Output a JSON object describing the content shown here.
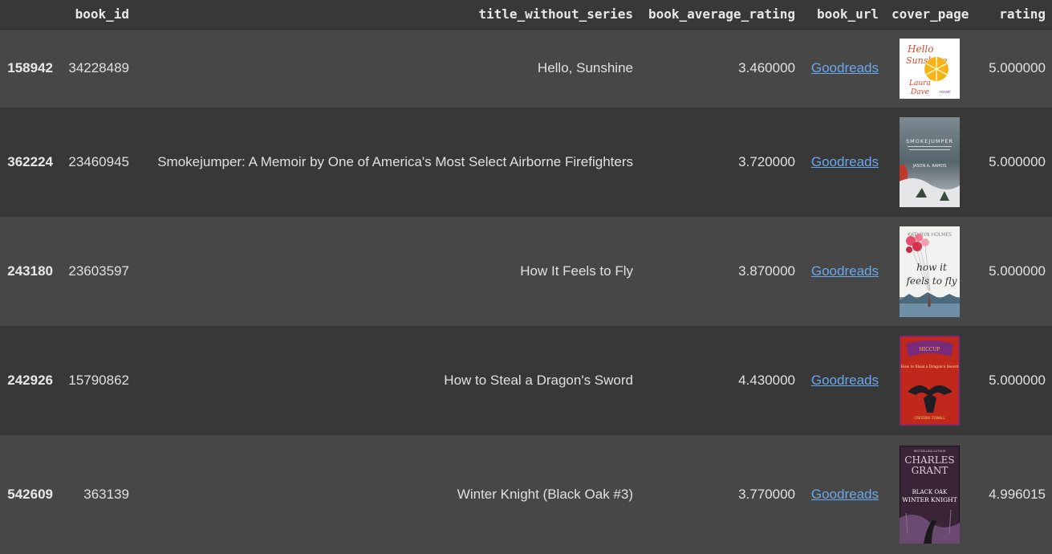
{
  "columns": [
    "",
    "book_id",
    "title_without_series",
    "book_average_rating",
    "book_url",
    "cover_page",
    "rating"
  ],
  "rows": [
    {
      "index": "158942",
      "book_id": "34228489",
      "title": "Hello, Sunshine",
      "avg_rating": "3.460000",
      "url_label": "Goodreads",
      "cover": {
        "name": "hello-sunshine-cover",
        "text_main": "Hello Sunshine",
        "text_author": "Laura Dave",
        "bg": "#ffffff",
        "accent": "#f4b41a"
      },
      "rating": "5.000000"
    },
    {
      "index": "362224",
      "book_id": "23460945",
      "title": "Smokejumper: A Memoir by One of America's Most Select Airborne Firefighters",
      "avg_rating": "3.720000",
      "url_label": "Goodreads",
      "cover": {
        "name": "smokejumper-cover",
        "text_main": "SMOKEJUMPER",
        "text_author": "JASON A. RAMOS",
        "bg": "#4a5a66",
        "accent": "#c0392b"
      },
      "rating": "5.000000"
    },
    {
      "index": "243180",
      "book_id": "23603597",
      "title": "How It Feels to Fly",
      "avg_rating": "3.870000",
      "url_label": "Goodreads",
      "cover": {
        "name": "how-it-feels-to-fly-cover",
        "text_main": "how it feels to fly",
        "text_author": "KATHRYN HOLMES",
        "bg": "#f2f2f0",
        "accent": "#e84a6a"
      },
      "rating": "5.000000"
    },
    {
      "index": "242926",
      "book_id": "15790862",
      "title": "How to Steal a Dragon's Sword",
      "avg_rating": "4.430000",
      "url_label": "Goodreads",
      "cover": {
        "name": "how-to-steal-a-dragons-sword-cover",
        "text_main": "How to Steal a Dragon's Sword",
        "text_author": "CRESSIDA COWELL",
        "bg": "#c0281c",
        "accent": "#7a2a7a"
      },
      "rating": "5.000000"
    },
    {
      "index": "542609",
      "book_id": "363139",
      "title": "Winter Knight (Black Oak #3)",
      "avg_rating": "3.770000",
      "url_label": "Goodreads",
      "cover": {
        "name": "winter-knight-cover",
        "text_main": "WINTER KNIGHT",
        "text_author": "CHARLES GRANT",
        "bg": "#3a2438",
        "accent": "#c9a0c0"
      },
      "rating": "4.996015"
    }
  ]
}
